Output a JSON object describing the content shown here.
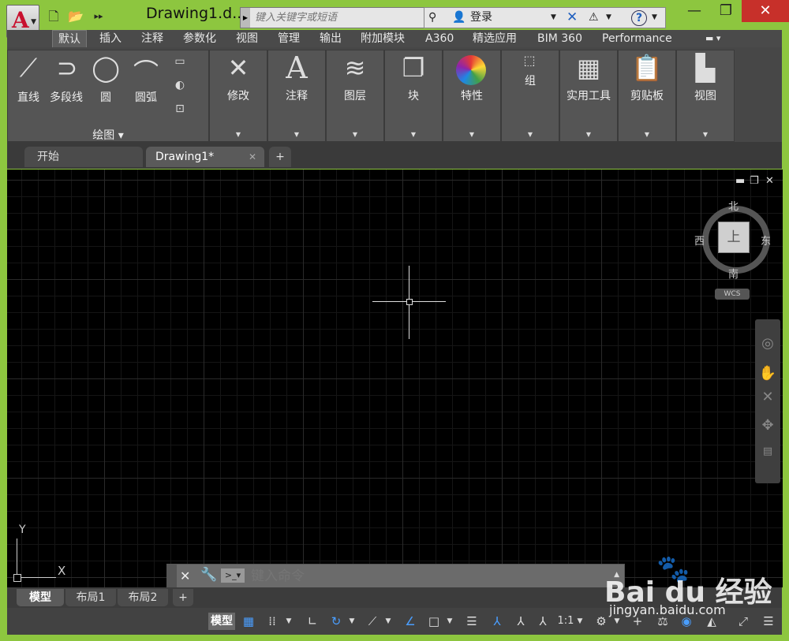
{
  "titlebar": {
    "title": "Drawing1.d...",
    "search_placeholder": "键入关键字或短语",
    "login": "登录",
    "help": "?"
  },
  "ribbon_tabs": [
    "默认",
    "插入",
    "注释",
    "参数化",
    "视图",
    "管理",
    "输出",
    "附加模块",
    "A360",
    "精选应用",
    "BIM 360",
    "Performance"
  ],
  "draw_panel": {
    "tools": [
      "直线",
      "多段线",
      "圆",
      "圆弧"
    ],
    "label": "绘图"
  },
  "panels": [
    "修改",
    "注释",
    "图层",
    "块",
    "特性",
    "组",
    "实用工具",
    "剪贴板",
    "视图"
  ],
  "doc_tabs": {
    "start": "开始",
    "drawing": "Drawing1*",
    "add": "+"
  },
  "viewcube": {
    "top": "上",
    "north": "北",
    "south": "南",
    "east": "东",
    "west": "西",
    "wcs": "WCS"
  },
  "ucs": {
    "x": "X",
    "y": "Y"
  },
  "command_line": {
    "placeholder": "键入命令"
  },
  "layout_tabs": [
    "模型",
    "布局1",
    "布局2"
  ],
  "statusbar": {
    "model": "模型",
    "scale": "1:1"
  },
  "watermark": {
    "main": "Bai du 经验",
    "sub": "jingyan.baidu.com"
  },
  "colors": {
    "window_border": "#8dc63f",
    "canvas": "#000000",
    "ribbon": "#474747",
    "close": "#c7302a"
  }
}
